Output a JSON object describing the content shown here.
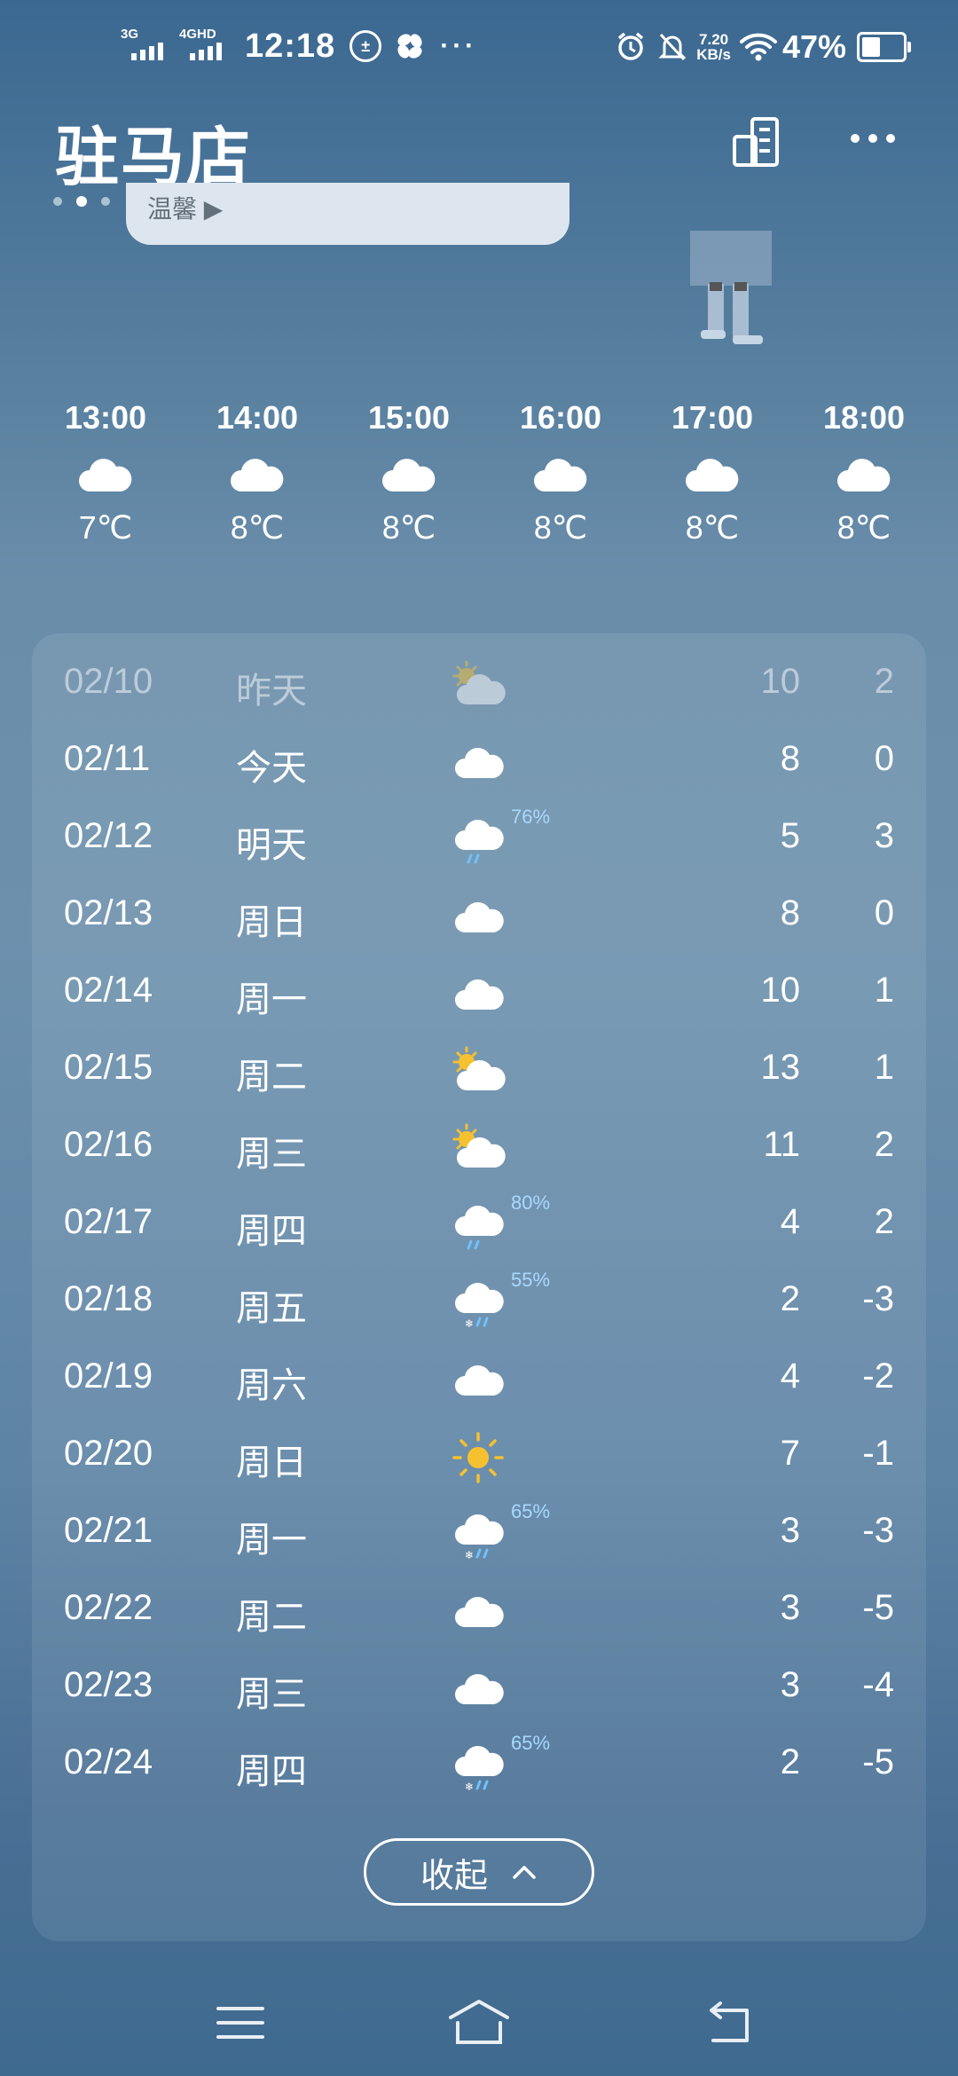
{
  "status_bar": {
    "network_1": "3G",
    "network_2": "4GHD",
    "time": "12:18",
    "circle_icon_text": "±",
    "more_dots": "···",
    "speed_value": "7.20",
    "speed_unit": "KB/s",
    "battery": "47%"
  },
  "header": {
    "city": "驻马店",
    "city_list_icon": "buildings-icon",
    "more_icon": "more-icon"
  },
  "banner": {
    "text": "温馨 ▶"
  },
  "hourly": [
    {
      "time": "13:00",
      "icon": "cloud-icon",
      "temp": "7℃"
    },
    {
      "time": "14:00",
      "icon": "cloud-icon",
      "temp": "8℃"
    },
    {
      "time": "15:00",
      "icon": "cloud-icon",
      "temp": "8℃"
    },
    {
      "time": "16:00",
      "icon": "cloud-icon",
      "temp": "8℃"
    },
    {
      "time": "17:00",
      "icon": "cloud-icon",
      "temp": "8℃"
    },
    {
      "time": "18:00",
      "icon": "cloud-icon",
      "temp": "8℃"
    }
  ],
  "daily": [
    {
      "date": "02/10",
      "day": "昨天",
      "icon": "partly-cloudy",
      "pct": "",
      "hi": "10",
      "lo": "2",
      "past": true
    },
    {
      "date": "02/11",
      "day": "今天",
      "icon": "cloud",
      "pct": "",
      "hi": "8",
      "lo": "0",
      "past": false
    },
    {
      "date": "02/12",
      "day": "明天",
      "icon": "rain",
      "pct": "76%",
      "hi": "5",
      "lo": "3",
      "past": false
    },
    {
      "date": "02/13",
      "day": "周日",
      "icon": "cloud",
      "pct": "",
      "hi": "8",
      "lo": "0",
      "past": false
    },
    {
      "date": "02/14",
      "day": "周一",
      "icon": "cloud",
      "pct": "",
      "hi": "10",
      "lo": "1",
      "past": false
    },
    {
      "date": "02/15",
      "day": "周二",
      "icon": "partly-cloudy",
      "pct": "",
      "hi": "13",
      "lo": "1",
      "past": false
    },
    {
      "date": "02/16",
      "day": "周三",
      "icon": "partly-cloudy",
      "pct": "",
      "hi": "11",
      "lo": "2",
      "past": false
    },
    {
      "date": "02/17",
      "day": "周四",
      "icon": "rain",
      "pct": "80%",
      "hi": "4",
      "lo": "2",
      "past": false
    },
    {
      "date": "02/18",
      "day": "周五",
      "icon": "sleet",
      "pct": "55%",
      "hi": "2",
      "lo": "-3",
      "past": false
    },
    {
      "date": "02/19",
      "day": "周六",
      "icon": "cloud",
      "pct": "",
      "hi": "4",
      "lo": "-2",
      "past": false
    },
    {
      "date": "02/20",
      "day": "周日",
      "icon": "sun",
      "pct": "",
      "hi": "7",
      "lo": "-1",
      "past": false
    },
    {
      "date": "02/21",
      "day": "周一",
      "icon": "sleet",
      "pct": "65%",
      "hi": "3",
      "lo": "-3",
      "past": false
    },
    {
      "date": "02/22",
      "day": "周二",
      "icon": "cloud",
      "pct": "",
      "hi": "3",
      "lo": "-5",
      "past": false
    },
    {
      "date": "02/23",
      "day": "周三",
      "icon": "cloud",
      "pct": "",
      "hi": "3",
      "lo": "-4",
      "past": false
    },
    {
      "date": "02/24",
      "day": "周四",
      "icon": "sleet",
      "pct": "65%",
      "hi": "2",
      "lo": "-5",
      "past": false
    }
  ],
  "collapse": {
    "label": "收起"
  },
  "nav": {
    "menu": "menu-icon",
    "home": "home-icon",
    "back": "back-icon"
  }
}
